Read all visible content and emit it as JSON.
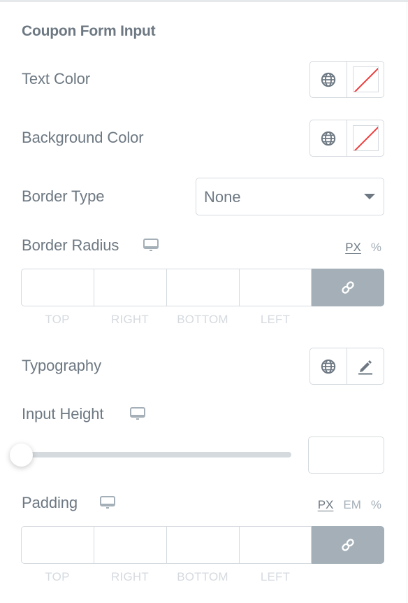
{
  "section": {
    "title": "Coupon Form Input"
  },
  "controls": {
    "text_color": {
      "label": "Text Color",
      "global_icon": "globe-icon",
      "swatch": "no-color"
    },
    "background_color": {
      "label": "Background Color",
      "global_icon": "globe-icon",
      "swatch": "no-color"
    },
    "border_type": {
      "label": "Border Type",
      "value": "None",
      "icon": "caret-down-icon"
    },
    "border_radius": {
      "label": "Border Radius",
      "responsive_icon": "desktop-icon",
      "units": [
        "PX",
        "%"
      ],
      "active_unit": "PX",
      "fields": [
        {
          "label": "TOP",
          "value": ""
        },
        {
          "label": "RIGHT",
          "value": ""
        },
        {
          "label": "BOTTOM",
          "value": ""
        },
        {
          "label": "LEFT",
          "value": ""
        }
      ],
      "link_icon": "link-icon"
    },
    "typography": {
      "label": "Typography",
      "global_icon": "globe-icon",
      "edit_icon": "pencil-icon"
    },
    "input_height": {
      "label": "Input Height",
      "responsive_icon": "desktop-icon",
      "slider_fraction": 0,
      "value": ""
    },
    "padding": {
      "label": "Padding",
      "responsive_icon": "desktop-icon",
      "units": [
        "PX",
        "EM",
        "%"
      ],
      "active_unit": "PX",
      "fields": [
        {
          "label": "TOP",
          "value": ""
        },
        {
          "label": "RIGHT",
          "value": ""
        },
        {
          "label": "BOTTOM",
          "value": ""
        },
        {
          "label": "LEFT",
          "value": ""
        }
      ],
      "link_icon": "link-icon"
    }
  },
  "colors": {
    "text": "#6d7882",
    "border": "#d5dadf",
    "muted": "#a4afb7",
    "no_color_line": "#ef3b3b"
  }
}
